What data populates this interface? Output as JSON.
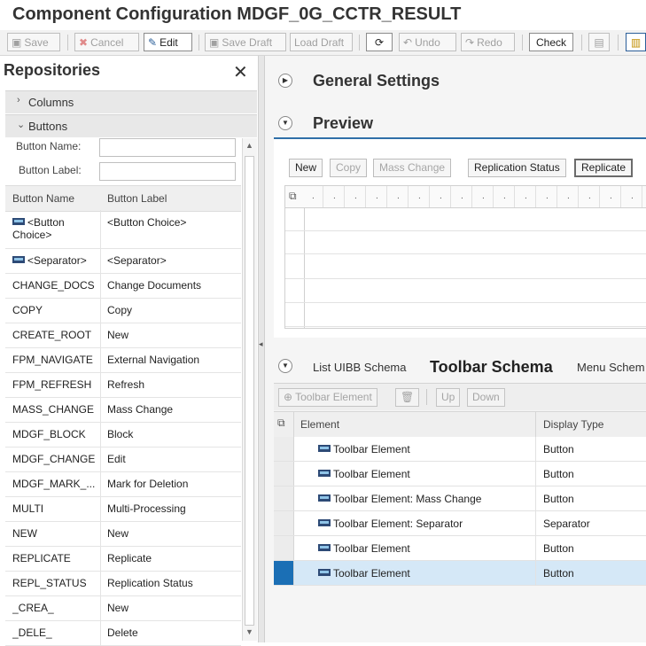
{
  "title": "Component Configuration MDGF_0G_CCTR_RESULT",
  "toolbar": {
    "save": "Save",
    "cancel": "Cancel",
    "edit": "Edit",
    "save_draft": "Save Draft",
    "load_draft": "Load Draft",
    "undo": "Undo",
    "redo": "Redo",
    "check": "Check"
  },
  "repositories": {
    "title": "Repositories",
    "sections": {
      "columns": "Columns",
      "buttons": "Buttons"
    },
    "form": {
      "button_name_label": "Button Name:",
      "button_label_label": "Button Label:"
    },
    "table": {
      "headers": [
        "Button Name",
        "Button Label"
      ],
      "rows": [
        {
          "name": "<Button Choice>",
          "label": "<Button Choice>"
        },
        {
          "name": "<Separator>",
          "label": "<Separator>"
        },
        {
          "name": "CHANGE_DOCS",
          "label": "Change Documents"
        },
        {
          "name": "COPY",
          "label": "Copy"
        },
        {
          "name": "CREATE_ROOT",
          "label": "New"
        },
        {
          "name": "FPM_NAVIGATE",
          "label": "External Navigation"
        },
        {
          "name": "FPM_REFRESH",
          "label": "Refresh"
        },
        {
          "name": "MASS_CHANGE",
          "label": "Mass Change"
        },
        {
          "name": "MDGF_BLOCK",
          "label": "Block"
        },
        {
          "name": "MDGF_CHANGE",
          "label": "Edit"
        },
        {
          "name": "MDGF_MARK_...",
          "label": "Mark for Deletion"
        },
        {
          "name": "MULTI",
          "label": "Multi-Processing"
        },
        {
          "name": "NEW",
          "label": "New"
        },
        {
          "name": "REPLICATE",
          "label": "Replicate"
        },
        {
          "name": "REPL_STATUS",
          "label": "Replication Status"
        },
        {
          "name": "_CREA_",
          "label": "New"
        },
        {
          "name": "_DELE_",
          "label": "Delete"
        }
      ]
    }
  },
  "general_settings": {
    "title": "General Settings"
  },
  "preview": {
    "title": "Preview",
    "buttons": {
      "new": "New",
      "copy": "Copy",
      "mass_change": "Mass Change",
      "replication_status": "Replication Status",
      "replicate": "Replicate"
    }
  },
  "schema_tabs": {
    "list": "List UIBB Schema",
    "toolbar": "Toolbar Schema",
    "menu": "Menu Schem"
  },
  "schema_toolbar": {
    "toolbar_element": "Toolbar Element",
    "up": "Up",
    "down": "Down"
  },
  "schema_table": {
    "headers": {
      "element": "Element",
      "display_type": "Display Type"
    },
    "rows": [
      {
        "element": "Toolbar Element",
        "type": "Button"
      },
      {
        "element": "Toolbar Element",
        "type": "Button"
      },
      {
        "element": "Toolbar Element: Mass Change",
        "type": "Button"
      },
      {
        "element": "Toolbar Element: Separator",
        "type": "Separator"
      },
      {
        "element": "Toolbar Element",
        "type": "Button"
      },
      {
        "element": "Toolbar Element",
        "type": "Button"
      }
    ],
    "selected_row": 6
  }
}
